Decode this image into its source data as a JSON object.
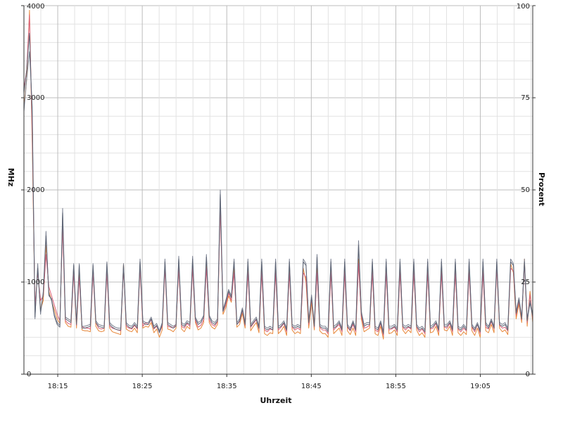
{
  "chart_data": {
    "type": "line",
    "title": "",
    "xlabel": "Uhrzeit",
    "ylabel": "MHz",
    "y2label": "Prozent",
    "x_ticks": [
      "18:15",
      "18:25",
      "18:35",
      "18:45",
      "18:55",
      "19:05"
    ],
    "x_tick_minutes": [
      15,
      25,
      35,
      45,
      55,
      65
    ],
    "xlim_minutes": [
      11,
      71.2
    ],
    "ylim": [
      0,
      4000
    ],
    "yticks": [
      0,
      1000,
      2000,
      3000,
      4000
    ],
    "y2lim": [
      0,
      100
    ],
    "y2ticks": [
      0,
      25,
      50,
      75,
      100
    ],
    "grid": true,
    "colors": [
      "#e8883a",
      "#d9607a",
      "#7a8090",
      "#5f6676"
    ],
    "series": [
      {
        "values": [
          2900,
          3200,
          3950,
          2500,
          700,
          1150,
          700,
          800,
          1400,
          900,
          800,
          700,
          600,
          550,
          1700,
          560,
          520,
          510,
          1150,
          500,
          1100,
          480,
          470,
          470,
          460,
          1150,
          520,
          470,
          460,
          470,
          1150,
          500,
          460,
          450,
          440,
          430,
          1200,
          490,
          470,
          460,
          500,
          450,
          1200,
          500,
          520,
          510,
          560,
          450,
          490,
          400,
          480,
          1200,
          490,
          480,
          460,
          500,
          1200,
          490,
          460,
          520,
          490,
          1200,
          560,
          480,
          500,
          560,
          1200,
          560,
          510,
          490,
          540,
          1900,
          650,
          720,
          850,
          780,
          1150,
          510,
          540,
          660,
          500,
          1150,
          470,
          520,
          560,
          450,
          1150,
          440,
          420,
          450,
          440,
          1150,
          440,
          470,
          520,
          420,
          1150,
          480,
          440,
          460,
          440,
          1150,
          1000,
          500,
          780,
          480,
          1150,
          470,
          440,
          440,
          400,
          1150,
          440,
          470,
          500,
          420,
          1150,
          470,
          430,
          500,
          420,
          1250,
          600,
          460,
          480,
          500,
          1150,
          440,
          420,
          520,
          380,
          1150,
          440,
          450,
          480,
          420,
          1150,
          480,
          440,
          480,
          450,
          1150,
          480,
          420,
          450,
          400,
          1150,
          450,
          460,
          520,
          420,
          1150,
          480,
          470,
          520,
          420,
          1150,
          450,
          420,
          460,
          430,
          1150,
          470,
          420,
          500,
          400,
          1150,
          470,
          450,
          540,
          450,
          1200,
          500,
          460,
          480,
          430,
          1200,
          1100,
          600,
          760,
          560,
          1250,
          520,
          900,
          560
        ]
      },
      {
        "values": [
          3100,
          3300,
          3900,
          2600,
          750,
          1100,
          800,
          850,
          1300,
          950,
          850,
          750,
          650,
          580,
          1600,
          580,
          550,
          540,
          1100,
          530,
          1050,
          520,
          500,
          500,
          490,
          1100,
          560,
          500,
          490,
          500,
          1100,
          520,
          500,
          490,
          480,
          470,
          1150,
          520,
          500,
          490,
          530,
          490,
          1150,
          520,
          560,
          540,
          590,
          490,
          520,
          450,
          520,
          1150,
          520,
          510,
          500,
          540,
          1150,
          520,
          500,
          550,
          520,
          1150,
          580,
          510,
          530,
          590,
          1150,
          590,
          540,
          520,
          570,
          1800,
          680,
          750,
          880,
          800,
          1100,
          540,
          570,
          690,
          530,
          1100,
          510,
          550,
          590,
          490,
          1100,
          480,
          460,
          490,
          480,
          1100,
          480,
          510,
          550,
          460,
          1100,
          510,
          480,
          500,
          480,
          1100,
          1050,
          540,
          820,
          510,
          1100,
          510,
          480,
          480,
          440,
          1100,
          480,
          510,
          540,
          460,
          1100,
          510,
          470,
          540,
          460,
          1200,
          630,
          500,
          510,
          530,
          1100,
          480,
          460,
          550,
          420,
          1100,
          480,
          490,
          510,
          460,
          1100,
          510,
          480,
          510,
          490,
          1100,
          510,
          460,
          490,
          440,
          1100,
          490,
          500,
          550,
          460,
          1100,
          510,
          500,
          550,
          460,
          1100,
          490,
          460,
          500,
          470,
          1100,
          510,
          460,
          540,
          440,
          1100,
          510,
          490,
          570,
          490,
          1150,
          530,
          500,
          510,
          470,
          1150,
          1120,
          640,
          790,
          590,
          1200,
          560,
          860,
          600
        ]
      },
      {
        "values": [
          2850,
          3200,
          3500,
          2900,
          600,
          1200,
          650,
          900,
          1550,
          850,
          820,
          650,
          560,
          530,
          1800,
          620,
          600,
          580,
          1200,
          560,
          1200,
          520,
          520,
          530,
          540,
          1200,
          580,
          540,
          530,
          520,
          1220,
          560,
          530,
          510,
          500,
          500,
          1200,
          560,
          530,
          520,
          560,
          520,
          1250,
          580,
          560,
          560,
          620,
          520,
          550,
          470,
          560,
          1250,
          560,
          540,
          520,
          540,
          1280,
          560,
          540,
          580,
          560,
          1280,
          620,
          560,
          580,
          640,
          1300,
          640,
          580,
          560,
          600,
          2000,
          700,
          800,
          920,
          850,
          1250,
          560,
          600,
          720,
          560,
          1250,
          540,
          580,
          620,
          520,
          1250,
          520,
          500,
          520,
          500,
          1250,
          520,
          540,
          580,
          500,
          1250,
          540,
          520,
          540,
          520,
          1250,
          1200,
          580,
          860,
          540,
          1300,
          540,
          520,
          520,
          480,
          1250,
          520,
          540,
          580,
          500,
          1250,
          540,
          500,
          580,
          500,
          1450,
          680,
          540,
          560,
          560,
          1250,
          520,
          500,
          580,
          460,
          1250,
          520,
          520,
          540,
          500,
          1250,
          540,
          520,
          540,
          520,
          1250,
          540,
          500,
          520,
          480,
          1250,
          520,
          540,
          580,
          500,
          1250,
          540,
          540,
          580,
          500,
          1250,
          520,
          500,
          540,
          500,
          1250,
          540,
          500,
          560,
          480,
          1250,
          560,
          520,
          600,
          520,
          1250,
          560,
          540,
          560,
          500,
          1250,
          1200,
          680,
          830,
          620,
          1250,
          600,
          800,
          650
        ]
      },
      {
        "values": [
          3050,
          3300,
          3700,
          2800,
          620,
          1150,
          680,
          870,
          1500,
          870,
          800,
          630,
          540,
          510,
          1750,
          600,
          580,
          560,
          1180,
          540,
          1180,
          500,
          500,
          510,
          520,
          1180,
          560,
          520,
          510,
          500,
          1200,
          540,
          510,
          490,
          480,
          480,
          1180,
          540,
          510,
          500,
          540,
          500,
          1220,
          560,
          540,
          540,
          600,
          500,
          530,
          450,
          540,
          1220,
          540,
          520,
          500,
          520,
          1250,
          540,
          520,
          560,
          540,
          1250,
          600,
          540,
          560,
          620,
          1270,
          620,
          560,
          540,
          580,
          1950,
          680,
          780,
          900,
          830,
          1220,
          540,
          580,
          700,
          540,
          1220,
          520,
          560,
          600,
          500,
          1220,
          500,
          480,
          500,
          480,
          1220,
          500,
          520,
          560,
          480,
          1220,
          520,
          500,
          520,
          500,
          1220,
          1180,
          560,
          840,
          520,
          1270,
          520,
          500,
          500,
          460,
          1220,
          500,
          520,
          560,
          480,
          1220,
          520,
          480,
          560,
          480,
          1400,
          660,
          520,
          540,
          540,
          1220,
          500,
          480,
          560,
          440,
          1220,
          500,
          500,
          520,
          480,
          1220,
          520,
          500,
          520,
          500,
          1220,
          520,
          480,
          500,
          460,
          1220,
          500,
          520,
          560,
          480,
          1220,
          520,
          520,
          560,
          480,
          1220,
          500,
          480,
          520,
          480,
          1220,
          520,
          480,
          540,
          460,
          1220,
          540,
          500,
          580,
          500,
          1220,
          540,
          520,
          540,
          480,
          1220,
          1180,
          660,
          810,
          600,
          1220,
          580,
          770,
          630
        ]
      }
    ]
  }
}
